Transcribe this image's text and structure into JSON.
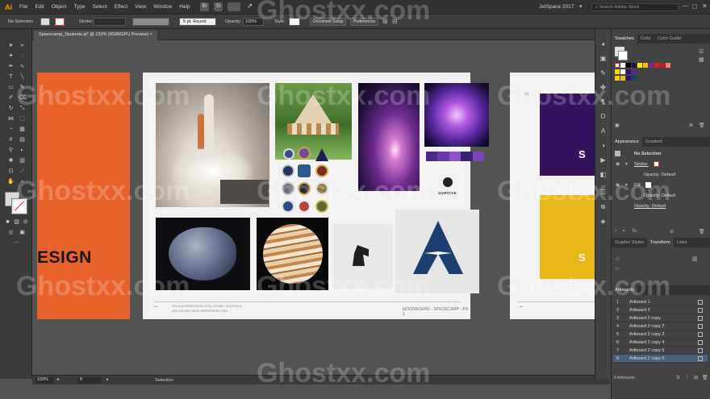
{
  "app": {
    "logo": "Ai",
    "workspace": "JetSpace 2017",
    "search_placeholder": "Search Adobe Stock"
  },
  "menus": [
    "File",
    "Edit",
    "Object",
    "Type",
    "Select",
    "Effect",
    "View",
    "Window",
    "Help"
  ],
  "control": {
    "selection": "No Selection",
    "stroke_label": "Stroke:",
    "brush": "5 pt. Round",
    "opacity_label": "Opacity:",
    "opacity_value": "100%",
    "style_label": "Style:",
    "doc_setup": "Document Setup",
    "preferences": "Preferences"
  },
  "document": {
    "tab_title": "Spacecamp_Students.ai* @ 150% (RGB/GPU Preview)"
  },
  "status": {
    "zoom": "150%",
    "page": "8",
    "tool": "Selection"
  },
  "panels": {
    "swatches_tabs": [
      "Swatches",
      "Color",
      "Color Guide"
    ],
    "appearance_tabs": [
      "Appearance",
      "Gradient"
    ],
    "appearance": {
      "title": "No Selection",
      "stroke": "Stroke:",
      "opacity1": "Opacity: Default",
      "fill": "Fill:",
      "opacity2": "Opacity: Default",
      "opacity3": "Opacity: Default",
      "fx": "fx."
    },
    "transform_tabs": [
      "Graphic Styles",
      "Transform",
      "Links"
    ],
    "artboards_tab": "Artboards",
    "artboards": [
      {
        "num": "1",
        "name": "Artboard 1"
      },
      {
        "num": "2",
        "name": "Artboard 2"
      },
      {
        "num": "3",
        "name": "Artboard 2 copy"
      },
      {
        "num": "4",
        "name": "Artboard 2 copy 2"
      },
      {
        "num": "5",
        "name": "Artboard 2 copy 3"
      },
      {
        "num": "6",
        "name": "Artboard 2 copy 4"
      },
      {
        "num": "7",
        "name": "Artboard 2 copy 5"
      },
      {
        "num": "8",
        "name": "Artboard 2 copy 6"
      }
    ],
    "artboards_count": "8 Artboards"
  },
  "artwork": {
    "left_heading": "ESIGN",
    "logo_text": "SURVIVE",
    "footer_left": "HELLO@JEREMYMURA.COM | SYDNEY, AUSTRALIA",
    "footer_left2": "0400 000 000 | WWW.JEREMYMURA.COM",
    "footer_right": "MOODBOARD - SPACECAMP - PG 1",
    "right_page_num": "01",
    "right_letter": "S",
    "right_letter2": "S"
  },
  "watermark": "Ghostxx.com",
  "colors": {
    "accent_orange": "#e85d2a",
    "purple": "#35125e",
    "yellow": "#e8b81a",
    "navy": "#1b3f6e"
  }
}
